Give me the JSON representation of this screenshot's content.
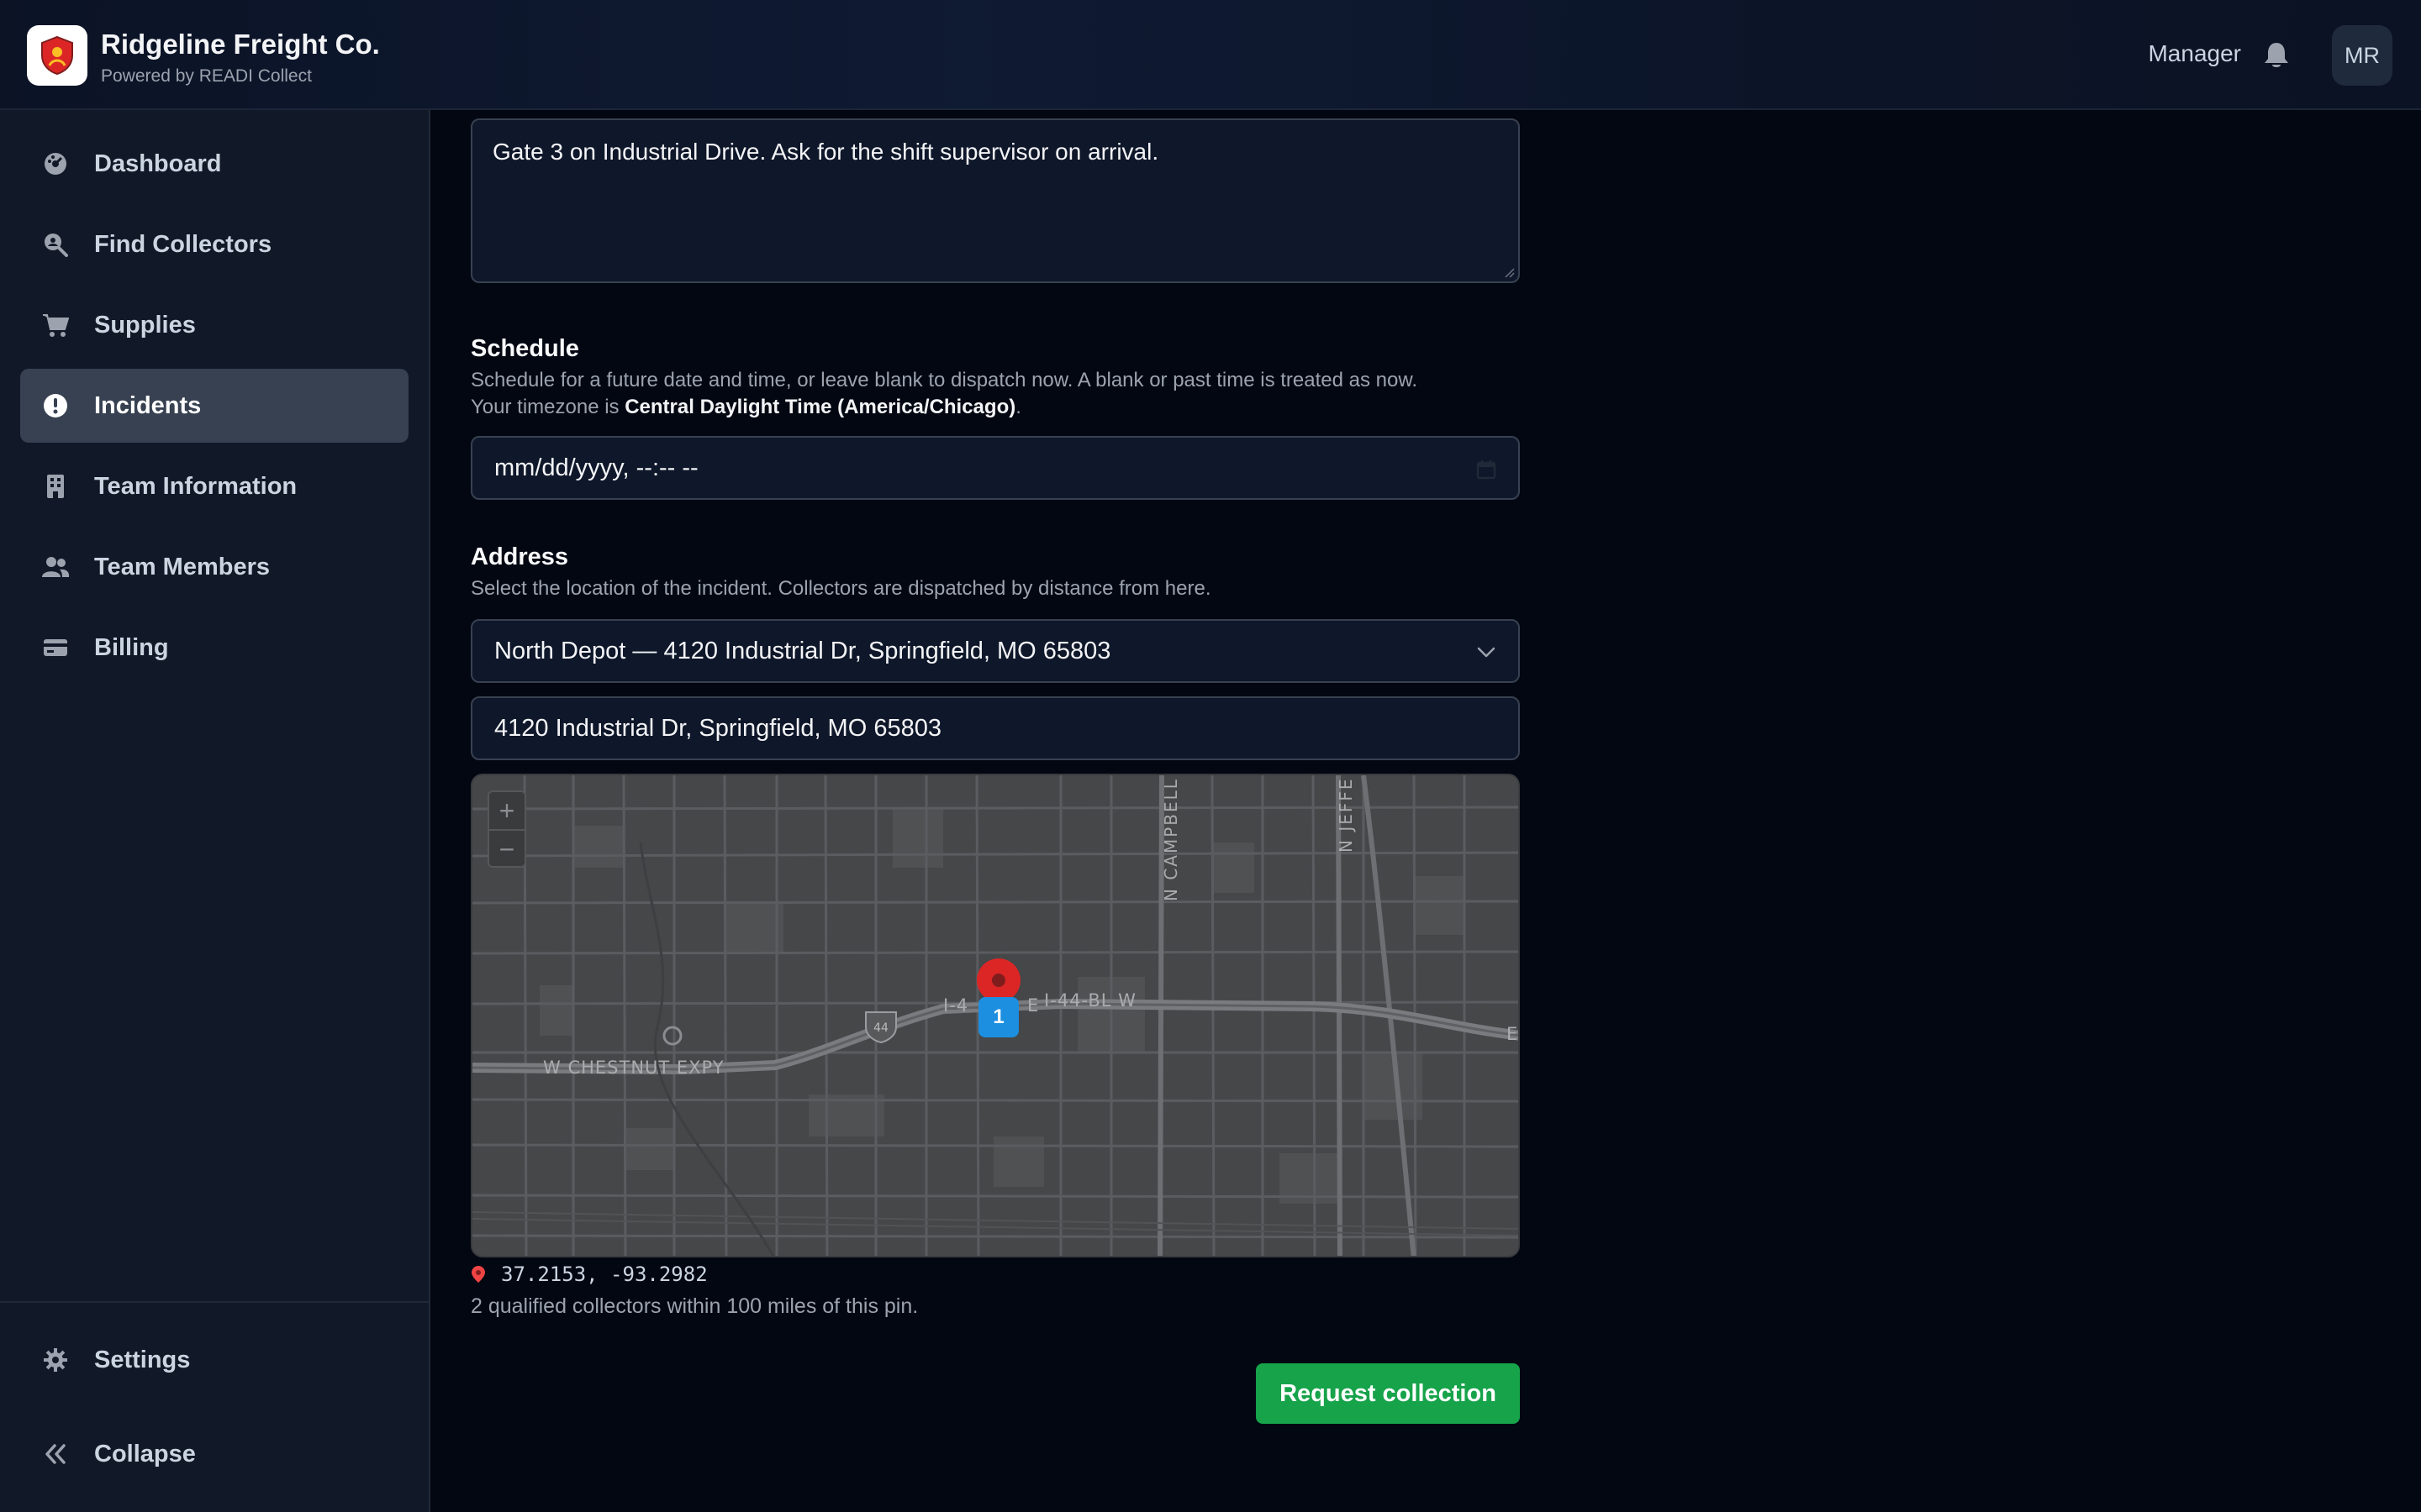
{
  "header": {
    "company_name": "Ridgeline Freight Co.",
    "powered_by": "Powered by READI Collect",
    "role": "Manager",
    "avatar_initials": "MR"
  },
  "sidebar": {
    "items": [
      {
        "label": "Dashboard",
        "icon": "dashboard-icon"
      },
      {
        "label": "Find Collectors",
        "icon": "search-person-icon"
      },
      {
        "label": "Supplies",
        "icon": "cart-icon"
      },
      {
        "label": "Incidents",
        "icon": "alert-icon",
        "active": true
      },
      {
        "label": "Team Information",
        "icon": "building-icon"
      },
      {
        "label": "Team Members",
        "icon": "users-icon"
      },
      {
        "label": "Billing",
        "icon": "credit-card-icon"
      }
    ],
    "settings_label": "Settings",
    "collapse_label": "Collapse"
  },
  "form": {
    "notes_value": "Gate 3 on Industrial Drive. Ask for the shift supervisor on arrival.",
    "schedule": {
      "title": "Schedule",
      "help_line1": "Schedule for a future date and time, or leave blank to dispatch now. A blank or past time is treated as now.",
      "help_line2_prefix": "Your timezone is ",
      "timezone": "Central Daylight Time (America/Chicago)",
      "help_line2_suffix": ".",
      "datetime_placeholder": "mm/dd/yyyy, --:-- --"
    },
    "address": {
      "title": "Address",
      "help": "Select the location of the incident. Collectors are dispatched by distance from here.",
      "selected_location": "North Depot — 4120 Industrial Dr, Springfield, MO 65803",
      "address_value": "4120 Industrial Dr, Springfield, MO 65803"
    },
    "map": {
      "zoom_in": "+",
      "zoom_out": "−",
      "labels": {
        "campbell": "N CAMPBELL",
        "jefferson": "N JEFFE",
        "i44_w": "I-44-BL W",
        "chestnut": "W CHESTNUT EXPY",
        "shield": "44",
        "i44_a": "I-4",
        "i44_b": "E",
        "e_edge": "E"
      },
      "marker_count": "1"
    },
    "coordinates": "37.2153, -93.2982",
    "collectors_note": "2 qualified collectors within 100 miles of this pin.",
    "submit_label": "Request collection"
  },
  "colors": {
    "accent_green": "#16a34a",
    "pin_red": "#dc2626",
    "badge_blue": "#1d8fe0",
    "active_nav": "#374151"
  }
}
